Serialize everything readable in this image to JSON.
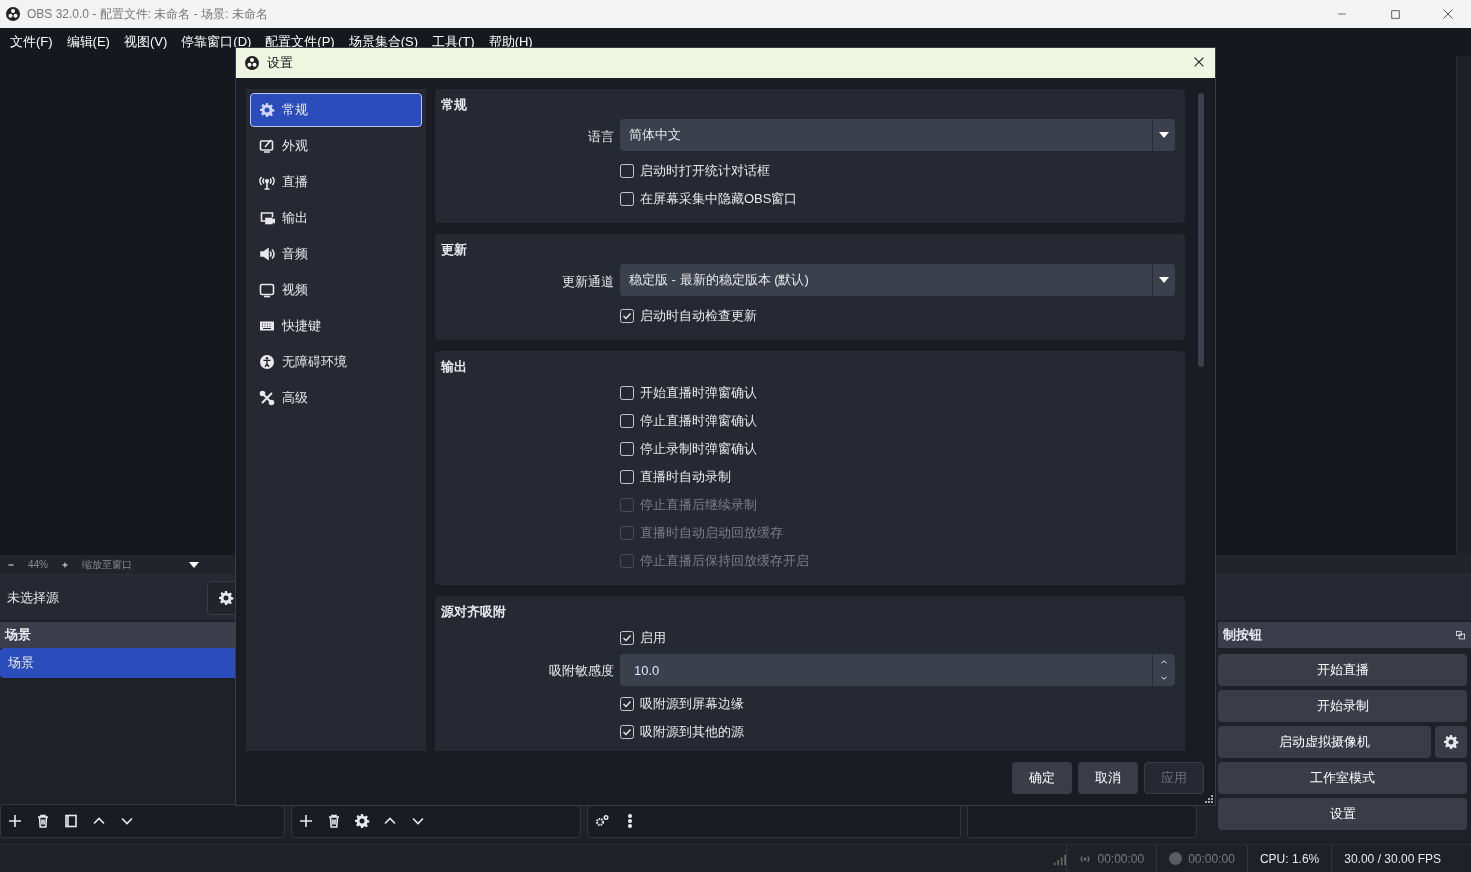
{
  "window": {
    "title": "OBS 32.0.0 - 配置文件: 未命名 - 场景: 未命名"
  },
  "menu": [
    "文件(F)",
    "编辑(E)",
    "视图(V)",
    "停靠窗口(D)",
    "配置文件(P)",
    "场景集合(S)",
    "工具(T)",
    "帮助(H)"
  ],
  "zoom_bar": {
    "zoom": "44%",
    "fit": "缩放至窗口"
  },
  "source_bar": {
    "label": "未选择源"
  },
  "scenes_dock": {
    "title": "场景",
    "items": [
      {
        "label": "场景",
        "selected": true
      }
    ]
  },
  "controls_dock": {
    "title": "制按钮",
    "buttons": [
      {
        "label": "开始直播",
        "kind": "plain"
      },
      {
        "label": "开始录制",
        "kind": "plain"
      },
      {
        "label": "启动虚拟摄像机",
        "kind": "with-gear"
      },
      {
        "label": "工作室模式",
        "kind": "plain"
      },
      {
        "label": "设置",
        "kind": "plain"
      }
    ]
  },
  "status_bar": {
    "stream_time": "00:00:00",
    "record_time": "00:00:00",
    "cpu": "CPU: 1.6%",
    "fps": "30.00 / 30.00 FPS"
  },
  "settings_dialog": {
    "title": "设置",
    "nav": [
      {
        "label": "常规",
        "selected": true
      },
      {
        "label": "外观",
        "selected": false
      },
      {
        "label": "直播",
        "selected": false
      },
      {
        "label": "输出",
        "selected": false
      },
      {
        "label": "音频",
        "selected": false
      },
      {
        "label": "视频",
        "selected": false
      },
      {
        "label": "快捷键",
        "selected": false
      },
      {
        "label": "无障碍环境",
        "selected": false
      },
      {
        "label": "高级",
        "selected": false
      }
    ],
    "sections": [
      {
        "title": "常规",
        "rows": [
          {
            "kind": "select",
            "label": "语言",
            "value": "简体中文"
          },
          {
            "kind": "checkbox",
            "label": "启动时打开统计对话框",
            "checked": false,
            "disabled": false
          },
          {
            "kind": "checkbox",
            "label": "在屏幕采集中隐藏OBS窗口",
            "checked": false,
            "disabled": false
          }
        ]
      },
      {
        "title": "更新",
        "rows": [
          {
            "kind": "select",
            "label": "更新通道",
            "value": "稳定版 - 最新的稳定版本 (默认)"
          },
          {
            "kind": "checkbox",
            "label": "启动时自动检查更新",
            "checked": true,
            "disabled": false
          }
        ]
      },
      {
        "title": "输出",
        "rows": [
          {
            "kind": "checkbox",
            "label": "开始直播时弹窗确认",
            "checked": false,
            "disabled": false
          },
          {
            "kind": "checkbox",
            "label": "停止直播时弹窗确认",
            "checked": false,
            "disabled": false
          },
          {
            "kind": "checkbox",
            "label": "停止录制时弹窗确认",
            "checked": false,
            "disabled": false
          },
          {
            "kind": "checkbox",
            "label": "直播时自动录制",
            "checked": false,
            "disabled": false
          },
          {
            "kind": "checkbox",
            "label": "停止直播后继续录制",
            "checked": false,
            "disabled": true
          },
          {
            "kind": "checkbox",
            "label": "直播时自动启动回放缓存",
            "checked": false,
            "disabled": true
          },
          {
            "kind": "checkbox",
            "label": "停止直播后保持回放缓存开启",
            "checked": false,
            "disabled": true
          }
        ]
      },
      {
        "title": "源对齐吸附",
        "rows": [
          {
            "kind": "checkbox",
            "label": "启用",
            "checked": true,
            "disabled": false
          },
          {
            "kind": "spinbox",
            "label": "吸附敏感度",
            "value": "10.0"
          },
          {
            "kind": "checkbox",
            "label": "吸附源到屏幕边缘",
            "checked": true,
            "disabled": false
          },
          {
            "kind": "checkbox",
            "label": "吸附源到其他的源",
            "checked": true,
            "disabled": false
          }
        ]
      }
    ],
    "buttons": [
      {
        "label": "确定",
        "disabled": false
      },
      {
        "label": "取消",
        "disabled": false
      },
      {
        "label": "应用",
        "disabled": true
      }
    ]
  }
}
